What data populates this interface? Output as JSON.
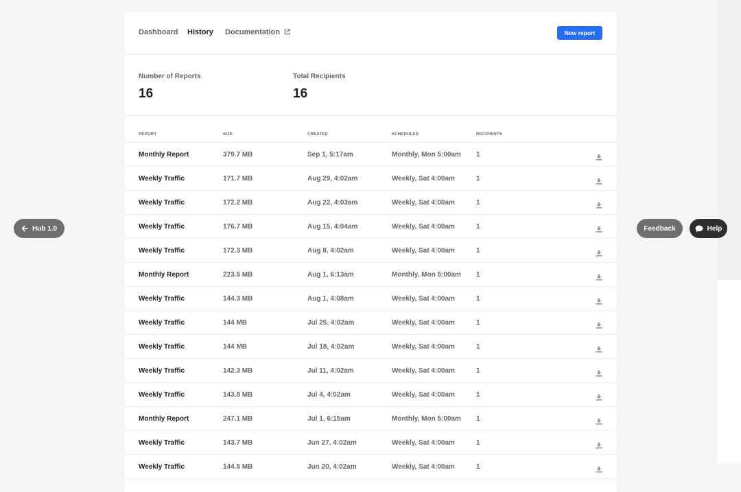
{
  "nav": {
    "dashboard": "Dashboard",
    "history": "History",
    "documentation": "Documentation",
    "new_report": "New report"
  },
  "stats": {
    "reports_label": "Number of Reports",
    "reports_value": "16",
    "recipients_label": "Total Recipients",
    "recipients_value": "16"
  },
  "table": {
    "columns": [
      "Report",
      "Size",
      "Created",
      "Scheduled",
      "Recipients"
    ],
    "rows": [
      {
        "name": "Monthly Report",
        "size": "379.7 MB",
        "created": "Sep 1, 5:17am",
        "scheduled": "Monthly, Mon 5:00am",
        "recipients": "1"
      },
      {
        "name": "Weekly Traffic",
        "size": "171.7 MB",
        "created": "Aug 29, 4:02am",
        "scheduled": "Weekly, Sat 4:00am",
        "recipients": "1"
      },
      {
        "name": "Weekly Traffic",
        "size": "172.2 MB",
        "created": "Aug 22, 4:03am",
        "scheduled": "Weekly, Sat 4:00am",
        "recipients": "1"
      },
      {
        "name": "Weekly Traffic",
        "size": "176.7 MB",
        "created": "Aug 15, 4:04am",
        "scheduled": "Weekly, Sat 4:00am",
        "recipients": "1"
      },
      {
        "name": "Weekly Traffic",
        "size": "172.3 MB",
        "created": "Aug 8, 4:02am",
        "scheduled": "Weekly, Sat 4:00am",
        "recipients": "1"
      },
      {
        "name": "Monthly Report",
        "size": "223.5 MB",
        "created": "Aug 1, 6:13am",
        "scheduled": "Monthly, Mon 5:00am",
        "recipients": "1"
      },
      {
        "name": "Weekly Traffic",
        "size": "144.3 MB",
        "created": "Aug 1, 4:08am",
        "scheduled": "Weekly, Sat 4:00am",
        "recipients": "1"
      },
      {
        "name": "Weekly Traffic",
        "size": "144 MB",
        "created": "Jul 25, 4:02am",
        "scheduled": "Weekly, Sat 4:00am",
        "recipients": "1"
      },
      {
        "name": "Weekly Traffic",
        "size": "144 MB",
        "created": "Jul 18, 4:02am",
        "scheduled": "Weekly, Sat 4:00am",
        "recipients": "1"
      },
      {
        "name": "Weekly Traffic",
        "size": "142.3 MB",
        "created": "Jul 11, 4:02am",
        "scheduled": "Weekly, Sat 4:00am",
        "recipients": "1"
      },
      {
        "name": "Weekly Traffic",
        "size": "143.8 MB",
        "created": "Jul 4, 4:02am",
        "scheduled": "Weekly, Sat 4:00am",
        "recipients": "1"
      },
      {
        "name": "Monthly Report",
        "size": "247.1 MB",
        "created": "Jul 1, 6:15am",
        "scheduled": "Monthly, Mon 5:00am",
        "recipients": "1"
      },
      {
        "name": "Weekly Traffic",
        "size": "143.7 MB",
        "created": "Jun 27, 4:02am",
        "scheduled": "Weekly, Sat 4:00am",
        "recipients": "1"
      },
      {
        "name": "Weekly Traffic",
        "size": "144.5 MB",
        "created": "Jun 20, 4:02am",
        "scheduled": "Weekly, Sat 4:00am",
        "recipients": "1"
      }
    ]
  },
  "floating": {
    "hub": "Hub 1.0",
    "feedback": "Feedback",
    "help": "Help"
  },
  "colors": {
    "primary": "#286ef1",
    "pill_gray": "#6e6e6e",
    "pill_dark": "#2e2e2e"
  },
  "icons": {
    "external": "external-link-icon",
    "download": "download-icon",
    "back": "arrow-left-icon",
    "chat": "chat-bubble-icon"
  }
}
